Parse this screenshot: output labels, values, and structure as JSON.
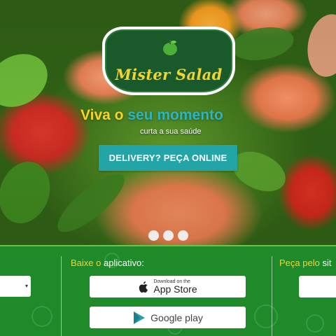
{
  "brand": {
    "name": "Mister Salad"
  },
  "hero": {
    "tagline_part1": "Viva o",
    "tagline_part2": "seu momento",
    "subtitle": "curta a sua saúde",
    "cta_label": "DELIVERY? PEÇA ONLINE",
    "slides": 3
  },
  "colors": {
    "green": "#1f8a2a",
    "yellow": "#f7d32a",
    "teal": "#23a5a8",
    "logo_green": "#1a5a2a"
  },
  "footer": {
    "app": {
      "title_part1": "Baixe o",
      "title_part2": "aplicativo",
      "title_colon": ":",
      "appstore_small": "Download on the",
      "appstore_big": "App Store",
      "googleplay": "Google play"
    },
    "site": {
      "title_part1": "Peça pelo",
      "title_part2": "sit"
    },
    "select": {
      "caret": "▾"
    }
  }
}
